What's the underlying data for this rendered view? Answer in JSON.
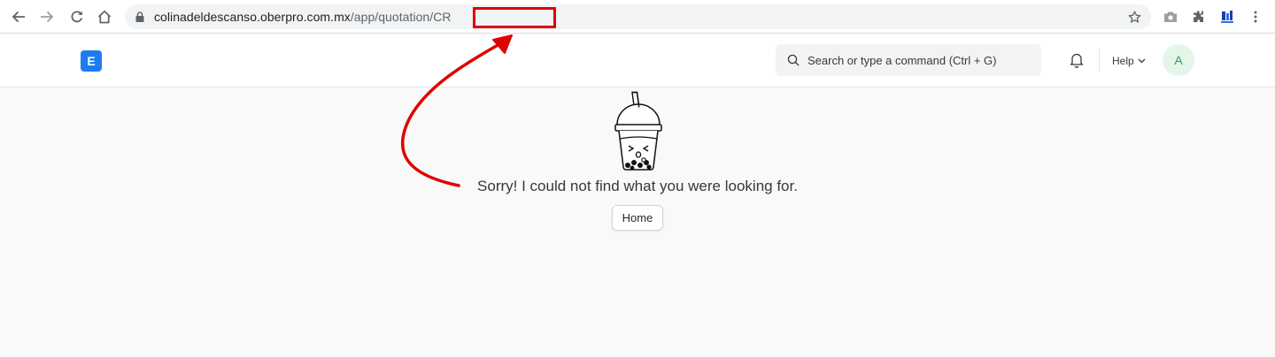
{
  "browser": {
    "url_domain": "colinadeldescanso.oberpro.com.mx",
    "url_path": "/app/quotation/CR"
  },
  "navbar": {
    "logo_letter": "E",
    "search_placeholder": "Search or type a command (Ctrl + G)",
    "help_label": "Help",
    "avatar_initial": "A"
  },
  "content": {
    "message": "Sorry! I could not find what you were looking for.",
    "home_button_label": "Home"
  },
  "colors": {
    "annotation": "#e00000",
    "logo": "#1f7cf0",
    "avatar_bg": "#e4f5e9",
    "avatar_text": "#2f9d58"
  },
  "icons": [
    "back-icon",
    "forward-icon",
    "reload-icon",
    "home-icon",
    "lock-icon",
    "star-icon",
    "camera-icon",
    "extensions-icon",
    "extension-app-icon",
    "menu-icon",
    "search-icon",
    "bell-icon",
    "chevron-down-icon"
  ]
}
